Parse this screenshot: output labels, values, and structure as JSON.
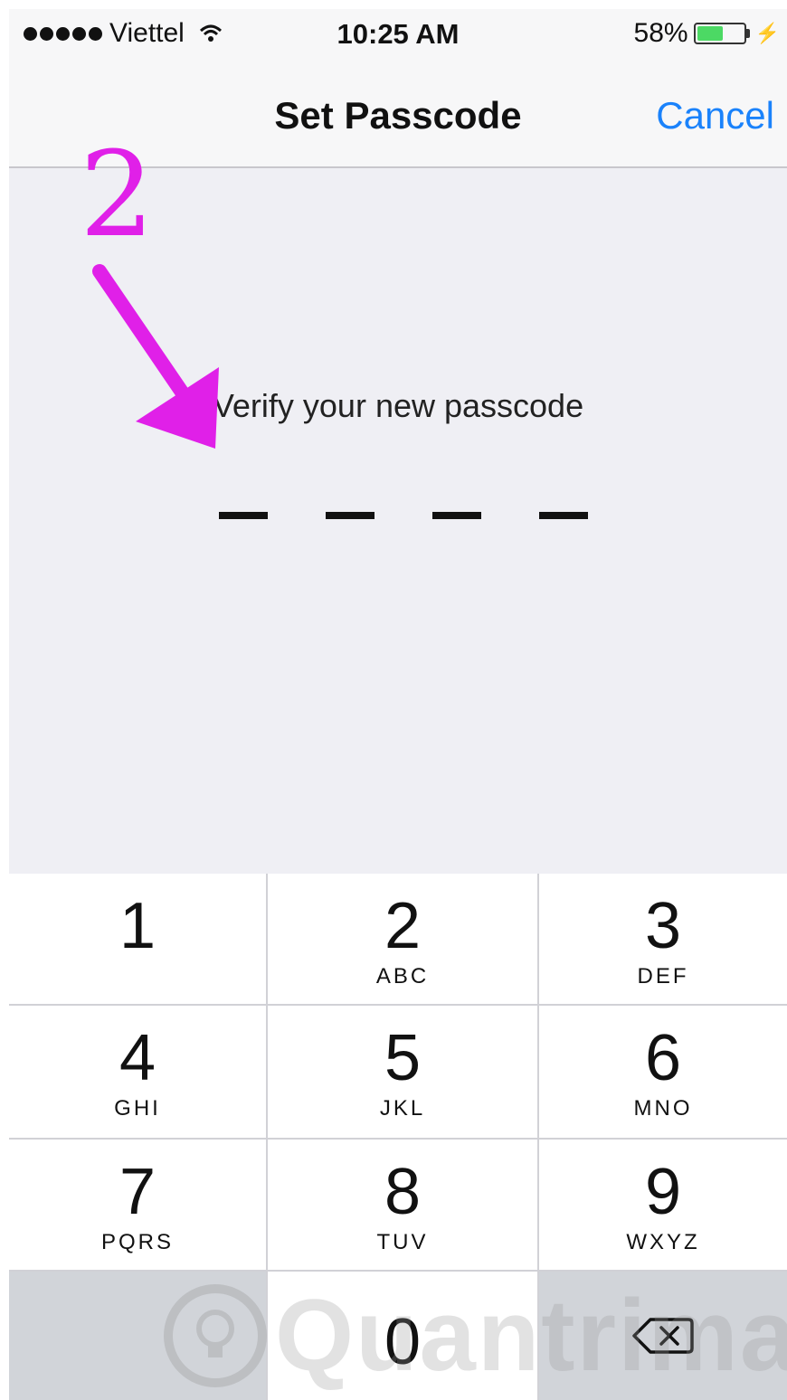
{
  "status_bar": {
    "carrier": "Viettel",
    "time": "10:25 AM",
    "battery_percent": "58%",
    "battery_level": 0.58
  },
  "nav": {
    "title": "Set Passcode",
    "cancel_label": "Cancel"
  },
  "content": {
    "prompt": "Verify your new passcode",
    "passcode_length": 4
  },
  "annotation": {
    "step_number": "2",
    "color": "#e020e8"
  },
  "keypad": {
    "keys": [
      {
        "digit": "1",
        "letters": ""
      },
      {
        "digit": "2",
        "letters": "ABC"
      },
      {
        "digit": "3",
        "letters": "DEF"
      },
      {
        "digit": "4",
        "letters": "GHI"
      },
      {
        "digit": "5",
        "letters": "JKL"
      },
      {
        "digit": "6",
        "letters": "MNO"
      },
      {
        "digit": "7",
        "letters": "PQRS"
      },
      {
        "digit": "8",
        "letters": "TUV"
      },
      {
        "digit": "9",
        "letters": "WXYZ"
      },
      {
        "digit": "0",
        "letters": ""
      }
    ]
  },
  "watermark": {
    "text": "Quantrimang"
  },
  "colors": {
    "accent": "#1a82fb",
    "battery_fill": "#4cd964",
    "background": "#efeff4"
  }
}
